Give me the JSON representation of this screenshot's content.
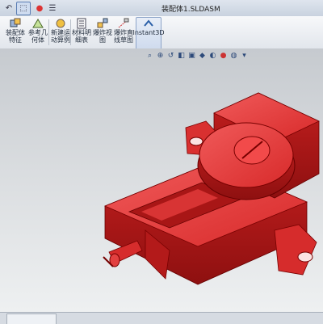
{
  "window": {
    "title": "装配体1.SLDASM"
  },
  "quick_access": [
    {
      "name": "undo-icon",
      "glyph": "↶"
    },
    {
      "name": "select-icon",
      "glyph": "⬚"
    },
    {
      "name": "traffic-light-icon",
      "glyph": "●"
    },
    {
      "name": "options-icon",
      "glyph": "☰"
    }
  ],
  "ribbon": {
    "buttons": [
      {
        "label": "装配体\n特征",
        "icon": "assembly-feature-icon"
      },
      {
        "label": "参考几\n何体",
        "icon": "reference-geometry-icon"
      },
      {
        "label": "新建运\n动算例",
        "icon": "new-motion-study-icon"
      },
      {
        "label": "材料明\n细表",
        "icon": "bill-of-materials-icon"
      },
      {
        "label": "爆炸视\n图",
        "icon": "exploded-view-icon"
      },
      {
        "label": "爆炸直\n线草图",
        "icon": "explode-line-sketch-icon"
      },
      {
        "label": "Instant3D",
        "icon": "instant3d-icon"
      }
    ],
    "active_button": "Instant3D"
  },
  "view_toolbar": [
    "zoom-to-fit-icon",
    "zoom-area-icon",
    "previous-view-icon",
    "section-view-icon",
    "view-orientation-icon",
    "display-style-icon",
    "hide-show-icon",
    "edit-appearance-icon",
    "apply-scene-icon",
    "view-settings-icon"
  ],
  "colors": {
    "model": "#e03030",
    "accent": "#5d7fb4"
  }
}
